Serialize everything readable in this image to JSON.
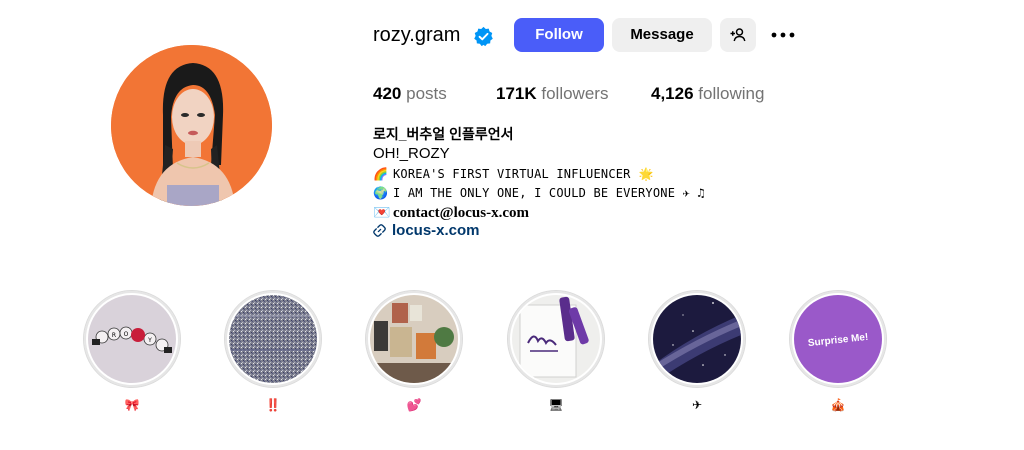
{
  "profile": {
    "username": "rozy.gram",
    "follow_label": "Follow",
    "message_label": "Message",
    "add_user_icon": "add-user-icon",
    "more_icon": "more-icon",
    "verified_icon": "verified-badge-icon"
  },
  "stats": {
    "posts_count": "420",
    "posts_label": "posts",
    "followers_count": "171K",
    "followers_label": "followers",
    "following_count": "4,126",
    "following_label": "following"
  },
  "bio": {
    "name": "로지_버추얼 인플루언서",
    "line1": "OH!_ROZY",
    "line2_emoji": "🌈",
    "line2": "KOREA'S FIRST VIRTUAL INFLUENCER",
    "line2_end": "🌟",
    "line3_emoji": "🌍",
    "line3": "I AM THE ONLY ONE, I COULD BE EVERYONE",
    "line3_end": "✈ ♫",
    "line4_emoji": "💌",
    "line4": "contact@locus-x.com",
    "link": "locus-x.com"
  },
  "highlights": [
    {
      "label": "🎀"
    },
    {
      "label": "‼️"
    },
    {
      "label": "💕"
    },
    {
      "label": "🖥"
    },
    {
      "label": "✈"
    },
    {
      "label": "🎪",
      "text": "Surprise Me!"
    }
  ],
  "colors": {
    "follow_button": "#4a5df9",
    "secondary_button": "#efefef",
    "link": "#00376b",
    "verified": "#0095f6",
    "avatar_bg": "#f27535"
  }
}
